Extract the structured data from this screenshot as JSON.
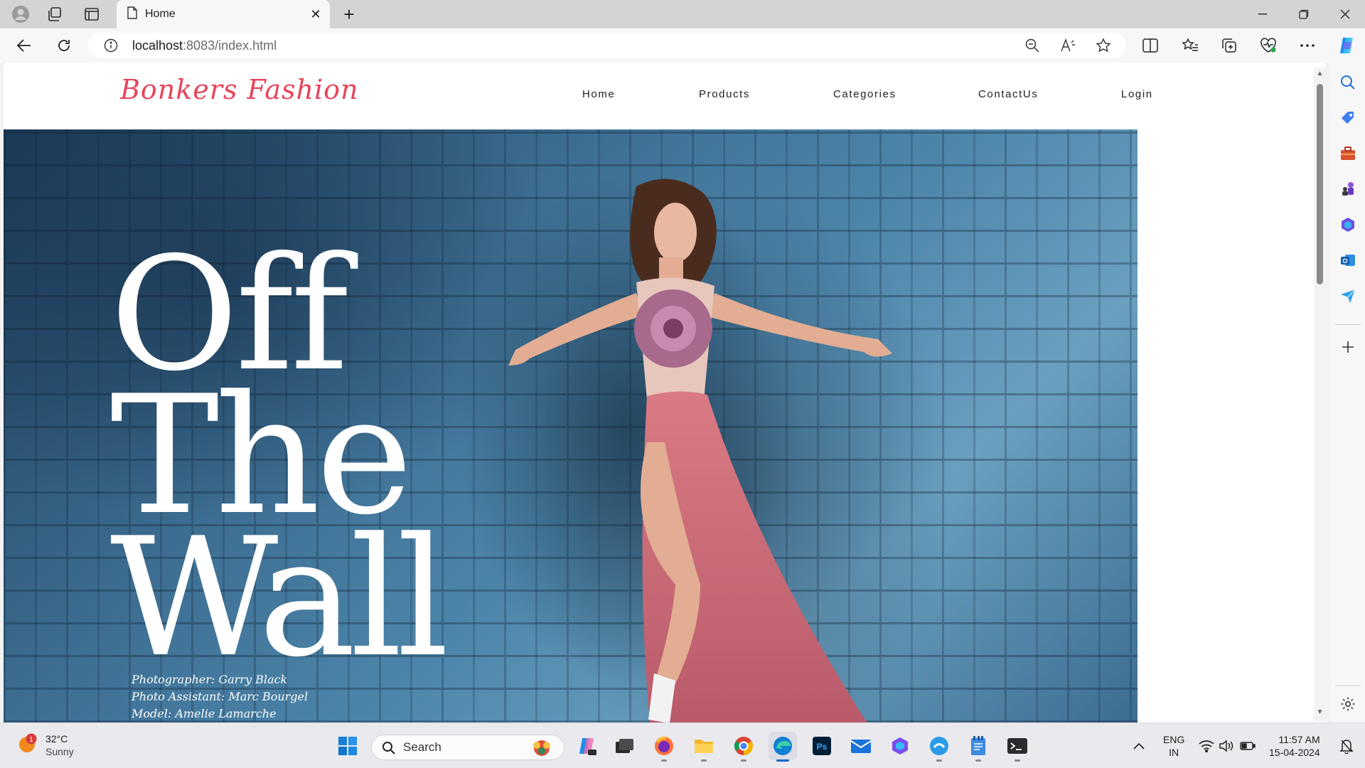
{
  "browser": {
    "tab_title": "Home",
    "url_host": "localhost",
    "url_rest": ":8083/index.html"
  },
  "site": {
    "logo": "Bonkers Fashion",
    "nav": [
      "Home",
      "Products",
      "Categories",
      "ContactUs",
      "Login"
    ],
    "hero": {
      "line1": "Off",
      "line2": "The",
      "line3": "Wall",
      "credits": [
        "Photographer: Garry Black",
        "Photo Assistant: Marc Bourgel",
        "Model: Amelie Lamarche"
      ]
    }
  },
  "taskbar": {
    "weather_badge": "1",
    "temperature": "32°C",
    "condition": "Sunny",
    "search_placeholder": "Search",
    "language": "ENG",
    "region": "IN",
    "time": "11:57 AM",
    "date": "15-04-2024"
  },
  "colors": {
    "logo": "#e8445a",
    "accent_edge": "#0a66c2"
  }
}
